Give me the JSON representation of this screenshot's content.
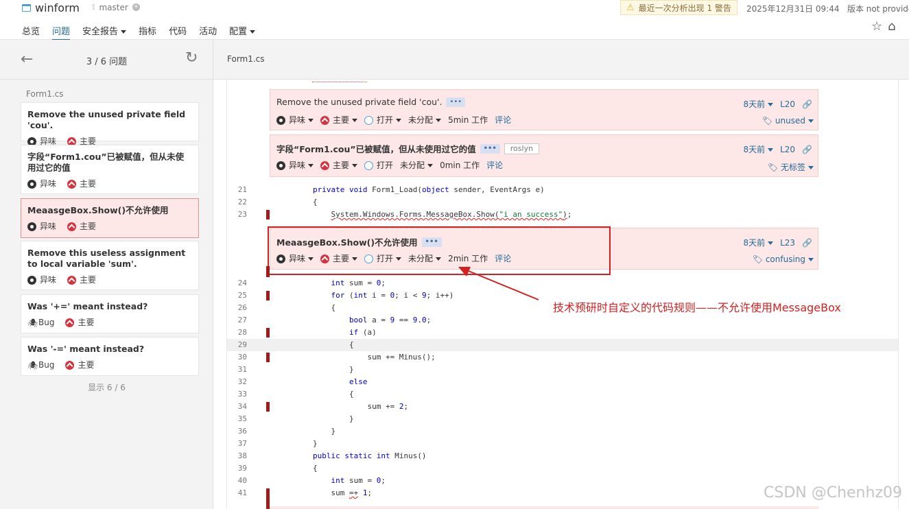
{
  "header": {
    "project": "winform",
    "branch": "master",
    "warning": "最近一次分析出现 1 警告",
    "date": "2025年12月31日 09:44",
    "version": "版本 not provided"
  },
  "nav": [
    "总览",
    "问题",
    "安全报告",
    "指标",
    "代码",
    "活动",
    "配置"
  ],
  "sidebar": {
    "counter": "3 / 6 问题",
    "file": "Form1.cs",
    "footer": "显示 6 / 6",
    "cards": [
      {
        "title": "Remove the unused private field 'cou'.",
        "type": "异味",
        "severity": "主要"
      },
      {
        "title": "字段“Form1.cou”已被赋值，但从未使用过它的值",
        "type": "异味",
        "severity": "主要"
      },
      {
        "title": "MeaasgeBox.Show()不允许使用",
        "type": "异味",
        "severity": "主要"
      },
      {
        "title": "Remove this useless assignment to local variable 'sum'.",
        "type": "异味",
        "severity": "主要"
      },
      {
        "title": "Was '+=' meant instead?",
        "type": "Bug",
        "severity": "主要"
      },
      {
        "title": "Was '-=' meant instead?",
        "type": "Bug",
        "severity": "主要"
      }
    ]
  },
  "main": {
    "filename": "Form1.cs",
    "issues": [
      {
        "message": "Remove the unused private field 'cou'.",
        "age": "8天前",
        "line": "L20",
        "type": "异味",
        "severity": "主要",
        "status": "打开",
        "assignee": "未分配",
        "effort": "5min 工作",
        "comment": "评论",
        "tags": "unused",
        "extra_tag": ""
      },
      {
        "message": "字段“Form1.cou”已被赋值，但从未使用过它的值",
        "age": "8天前",
        "line": "L20",
        "type": "异味",
        "severity": "主要",
        "status": "打开",
        "assignee": "未分配",
        "effort": "0min 工作",
        "comment": "评论",
        "tags": "无标签",
        "extra_tag": "roslyn"
      },
      {
        "message": "MeaasgeBox.Show()不允许使用",
        "age": "8天前",
        "line": "L23",
        "type": "异味",
        "severity": "主要",
        "status": "打开",
        "assignee": "未分配",
        "effort": "2min 工作",
        "comment": "评论",
        "tags": "confusing",
        "extra_tag": ""
      }
    ],
    "annotation": "技术预研时自定义的代码规则——不允许使用MessageBox",
    "watermark": "CSDN @Chenhz09"
  }
}
